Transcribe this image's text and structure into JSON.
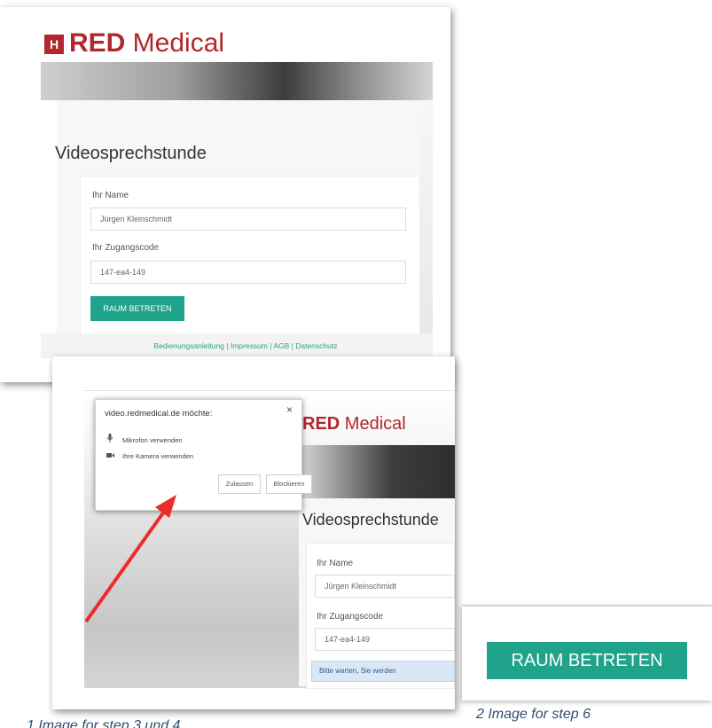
{
  "panel1": {
    "logo_mark": "H",
    "logo_bold": "RED",
    "logo_light": " Medical",
    "title": "Videosprechstunde",
    "name_label": "Ihr Name",
    "name_value": "Jürgen Kleinschmidt",
    "code_label": "Ihr Zugangscode",
    "code_value": "147-ea4-149",
    "enter_button": "RAUM BETRETEN",
    "footer_links": "Bedienungsanleitung | Impressum | AGB | Datenschutz"
  },
  "panel2": {
    "logo_bold": "RED",
    "logo_light": " Medical",
    "title": "Videosprechstunde",
    "name_label": "Ihr Name",
    "name_value": "Jürgen Kleinschmidt",
    "code_label": "Ihr Zugangscode",
    "code_value": "147-ea4-149",
    "wait_message": "Bitte warten, Sie werden",
    "dialog": {
      "title": "video.redmedical.de möchte:",
      "close": "×",
      "permissions": [
        "Mikrofon verwenden",
        "Ihre Kamera verwenden"
      ],
      "allow_button": "Zulassen",
      "block_button": "Blockieren"
    },
    "icons": [
      "microphone-icon",
      "camera-icon",
      "arrow-icon"
    ],
    "arrow_color": "#ee2b2b"
  },
  "panel3": {
    "enter_button": "RAUM BETRETEN"
  },
  "captions": {
    "caption1": "1 Image for step 3 und 4",
    "caption2": "2 Image for step 6"
  },
  "colors": {
    "brand_red": "#b3262c",
    "button_teal": "#1fa38a",
    "caption_blue": "#2f4f72"
  }
}
